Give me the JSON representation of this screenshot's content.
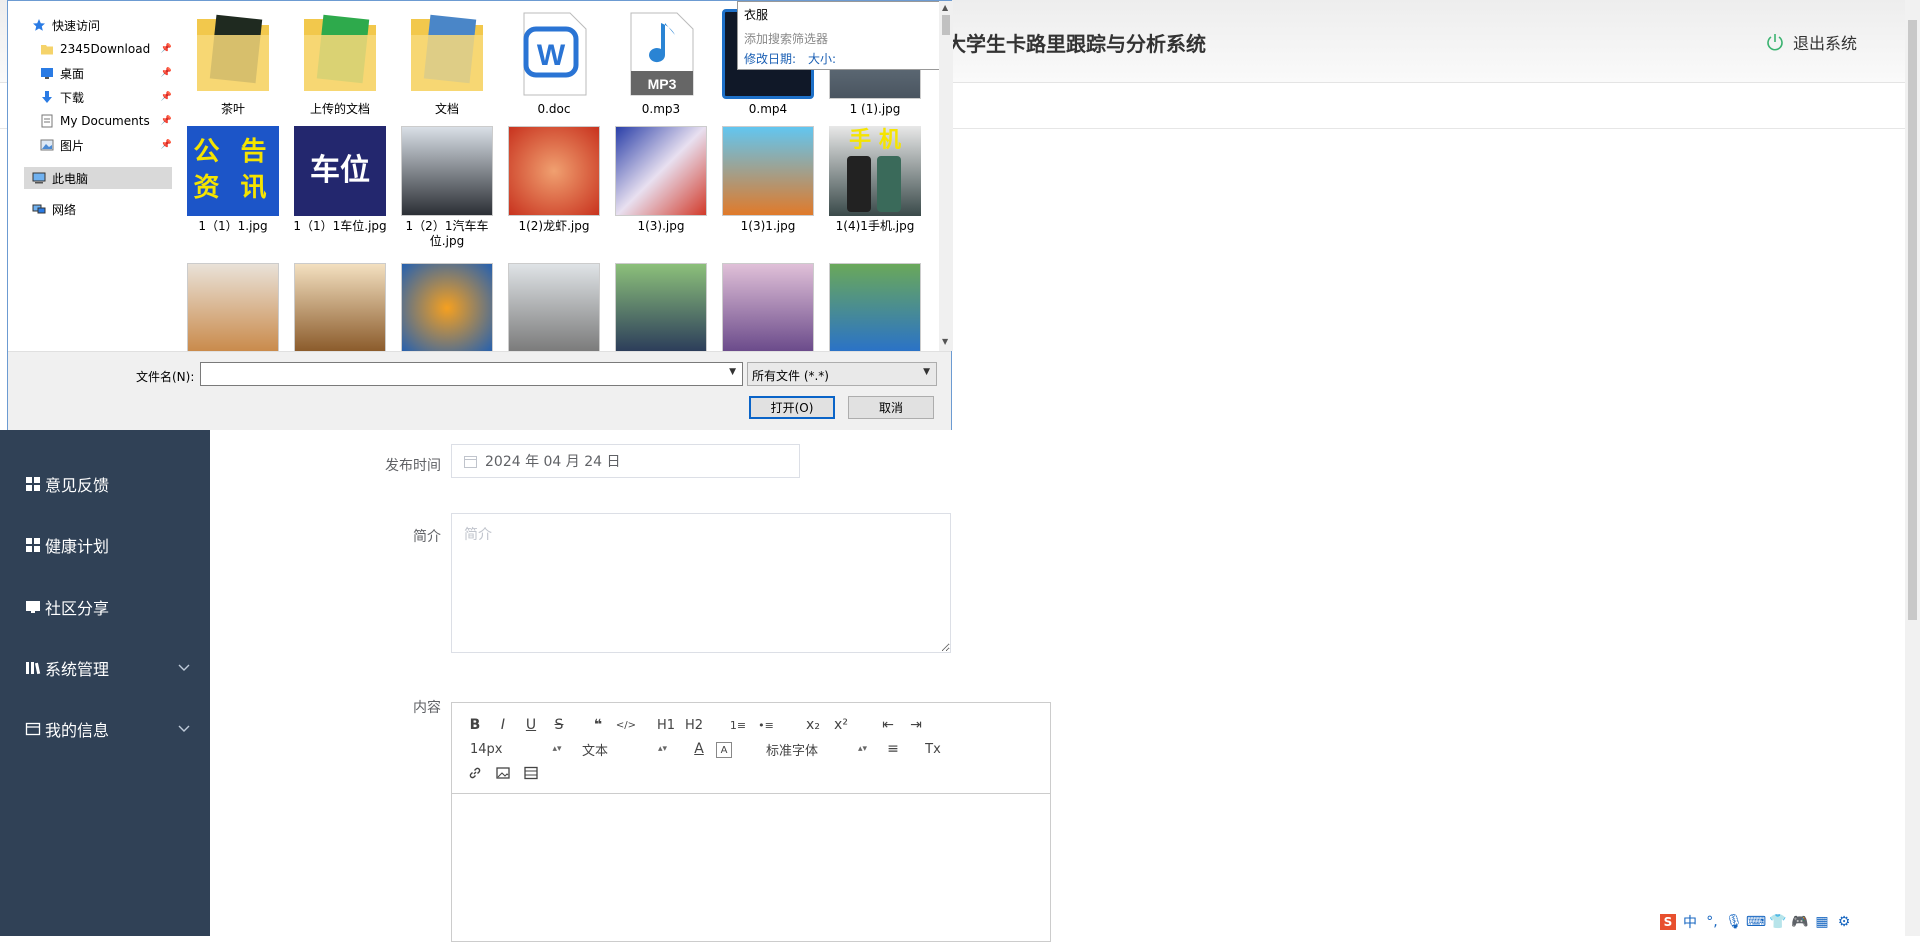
{
  "app": {
    "title": "大学生卡路里跟踪与分析系统",
    "logout": "退出系统"
  },
  "sidebar": {
    "items": [
      {
        "label": "意见反馈",
        "icon": "grid-icon"
      },
      {
        "label": "健康计划",
        "icon": "grid-icon"
      },
      {
        "label": "社区分享",
        "icon": "monitor-icon"
      },
      {
        "label": "系统管理",
        "icon": "library-icon"
      },
      {
        "label": "我的信息",
        "icon": "calendar-icon"
      }
    ]
  },
  "form": {
    "publish_label": "发布时间",
    "publish_value": "2024 年 04 月 24 日",
    "intro_label": "简介",
    "intro_placeholder": "简介",
    "content_label": "内容"
  },
  "editor": {
    "font_size": "14px",
    "block_type": "文本",
    "font_family": "标准字体",
    "buttons": [
      "B",
      "I",
      "U",
      "S",
      "❝",
      "</>",
      "H1",
      "H2",
      "1≡",
      "•≡",
      "x₂",
      "x²",
      "⇤",
      "⇥",
      "A",
      "A",
      "≡",
      "Tx",
      "link",
      "image",
      "video"
    ]
  },
  "dialog": {
    "nav": [
      {
        "label": "快速访问",
        "pinned": false
      },
      {
        "label": "2345Download",
        "pinned": true
      },
      {
        "label": "桌面",
        "pinned": true
      },
      {
        "label": "下载",
        "pinned": true
      },
      {
        "label": "My Documents",
        "pinned": true
      },
      {
        "label": "图片",
        "pinned": true
      },
      {
        "label": "此电脑",
        "pinned": false
      },
      {
        "label": "网络",
        "pinned": false
      }
    ],
    "popup": {
      "value": "衣服",
      "filter": "添加搜索筛选器",
      "date": "修改日期:",
      "size": "大小:"
    },
    "files": [
      {
        "name": "茶叶",
        "kind": "folder-dark"
      },
      {
        "name": "上传的文档",
        "kind": "folder-green"
      },
      {
        "name": "文档",
        "kind": "folder-blue"
      },
      {
        "name": "0.doc",
        "kind": "doc"
      },
      {
        "name": "0.mp3",
        "kind": "mp3"
      },
      {
        "name": "0.mp4",
        "kind": "mp4"
      },
      {
        "name": "1 (1).jpg",
        "kind": "photo-street"
      },
      {
        "name": "1（1）1.jpg",
        "kind": "notice",
        "line1": "公 告",
        "line2": "资 讯"
      },
      {
        "name": "1（1）1车位.jpg",
        "kind": "parking",
        "text": "车位"
      },
      {
        "name": "1（2）1汽车车位.jpg",
        "kind": "photo-car"
      },
      {
        "name": "1(2)龙虾.jpg",
        "kind": "photo-lobster"
      },
      {
        "name": "1(3).jpg",
        "kind": "photo-goku"
      },
      {
        "name": "1(3)1.jpg",
        "kind": "photo-goku2"
      },
      {
        "name": "1(4)1手机.jpg",
        "kind": "phone",
        "text": "手 机"
      },
      {
        "name": "",
        "kind": "photo-dog"
      },
      {
        "name": "",
        "kind": "photo-book"
      },
      {
        "name": "",
        "kind": "photo-orange"
      },
      {
        "name": "",
        "kind": "photo-boy"
      },
      {
        "name": "",
        "kind": "photo-girl1"
      },
      {
        "name": "",
        "kind": "photo-girl2"
      },
      {
        "name": "",
        "kind": "photo-kid"
      }
    ],
    "filename_label": "文件名(N):",
    "filename_value": "",
    "filetype": "所有文件 (*.*)",
    "open": "打开(O)",
    "cancel": "取消"
  },
  "tray": {
    "ime": "中"
  }
}
